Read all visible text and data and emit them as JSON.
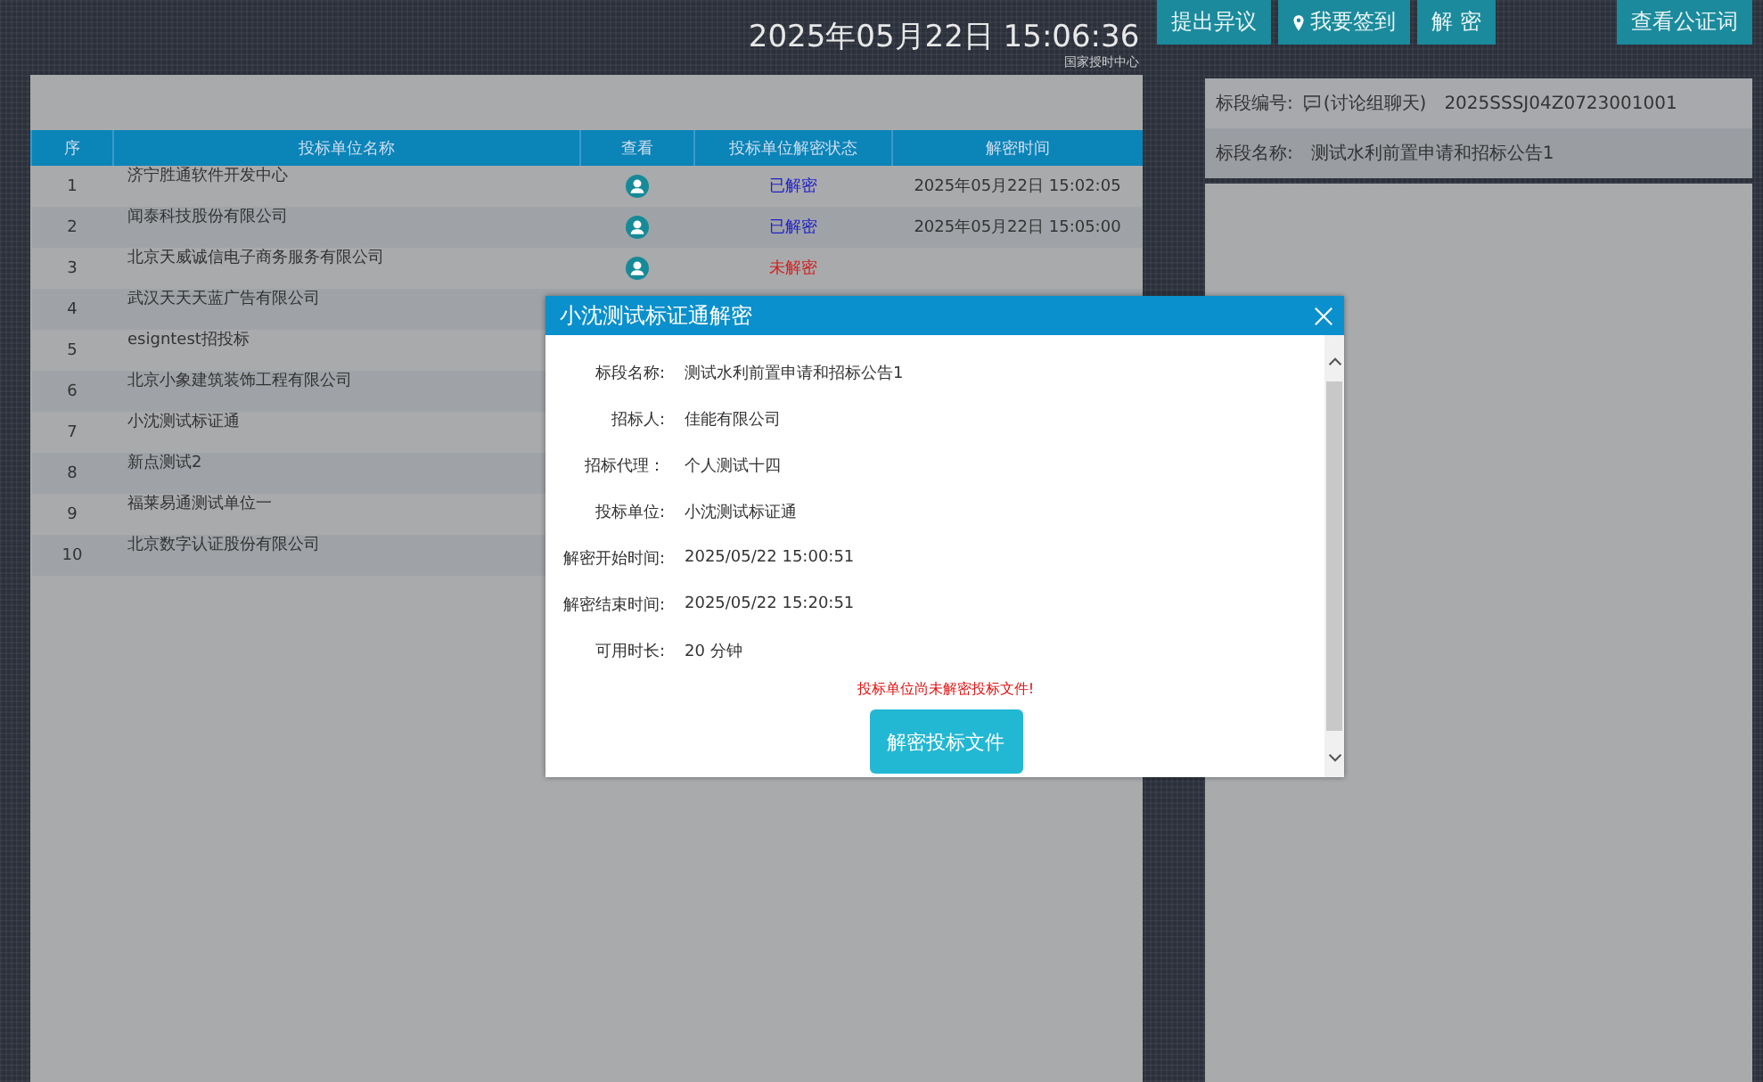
{
  "header": {
    "datetime": "2025年05月22日 15:06:36",
    "time_source": "国家授时中心",
    "buttons": [
      {
        "label": "提出异议",
        "kind": "plain"
      },
      {
        "label": "我要签到",
        "kind": "checkin"
      },
      {
        "label": "解 密",
        "kind": "plain"
      },
      {
        "label": "查看公证词",
        "kind": "plain"
      }
    ]
  },
  "table": {
    "columns": [
      "序",
      "投标单位名称",
      "查看",
      "投标单位解密状态",
      "解密时间"
    ],
    "rows": [
      {
        "index": "1",
        "name": "济宁胜通软件开发中心",
        "status": {
          "text": "已解密",
          "kind": "done"
        },
        "time": "2025年05月22日 15:02:05"
      },
      {
        "index": "2",
        "name": "闻泰科技股份有限公司",
        "status": {
          "text": "已解密",
          "kind": "done"
        },
        "time": "2025年05月22日 15:05:00"
      },
      {
        "index": "3",
        "name": "北京天威诚信电子商务服务有限公司",
        "status": {
          "text": "未解密",
          "kind": "pending"
        }
      },
      {
        "index": "4",
        "name": "武汉天天天蓝广告有限公司"
      },
      {
        "index": "5",
        "name": "esigntest招投标"
      },
      {
        "index": "6",
        "name": "北京小象建筑装饰工程有限公司"
      },
      {
        "index": "7",
        "name": "小沈测试标证通"
      },
      {
        "index": "8",
        "name": "新点测试2"
      },
      {
        "index": "9",
        "name": "福莱易通测试单位一"
      },
      {
        "index": "10",
        "name": "北京数字认证股份有限公司"
      }
    ]
  },
  "info_panel": {
    "rows": [
      {
        "label": "标段编号:",
        "chat_link": "(讨论组聊天)",
        "value": "2025SSSJ04Z0723001001"
      },
      {
        "label": "标段名称:",
        "value": "测试水利前置申请和招标公告1"
      }
    ]
  },
  "dialog": {
    "title": "小沈测试标证通解密",
    "fields": [
      {
        "label": "标段名称:",
        "value": "测试水利前置申请和招标公告1"
      },
      {
        "label": "招标人:",
        "value": "佳能有限公司"
      },
      {
        "label": "招标代理：",
        "value": "个人测试十四"
      },
      {
        "label": "投标单位:",
        "value": "小沈测试标证通"
      },
      {
        "label": "解密开始时间:",
        "value": "2025/05/22 15:00:51"
      },
      {
        "label": "解密结束时间:",
        "value": "2025/05/22 15:20:51"
      },
      {
        "label": "可用时长:",
        "value": "20 分钟"
      }
    ],
    "warning": "投标单位尚未解密投标文件!",
    "button": "解密投标文件"
  }
}
